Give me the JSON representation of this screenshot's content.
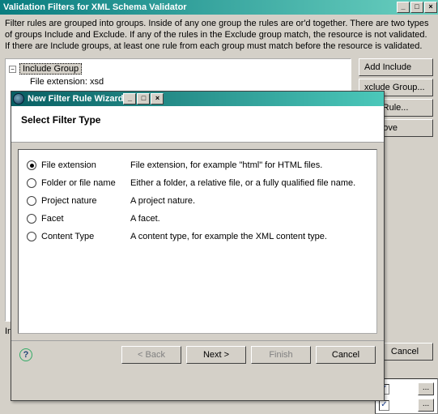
{
  "mainDialog": {
    "title": "Validation Filters for XML Schema Validator",
    "description": "Filter rules are grouped into groups. Inside of any one group the rules are or'd together. There are two types of groups Include and Exclude. If any of the rules in the Exclude group match, the resource is not validated. If there are Include groups, at least one rule from each group must match before the resource is validated.",
    "tree": {
      "root": "Include Group",
      "child": "File extension: xsd"
    },
    "sideButtons": {
      "addIncludeGroup": "Add Include Group...",
      "addExcludeGroup": "xclude Group...",
      "addRule": "Add Rule...",
      "remove": "Remove"
    },
    "includeLabel": "In",
    "cancel": "Cancel"
  },
  "bottom": {
    "dots": "..."
  },
  "wizard": {
    "title": "New Filter Rule Wizard",
    "heading": "Select Filter Type",
    "options": [
      {
        "label": "File extension",
        "desc": "File extension, for example \"html\" for HTML files.",
        "selected": true
      },
      {
        "label": "Folder or file name",
        "desc": "Either a folder, a relative file, or a fully qualified file name.",
        "selected": false
      },
      {
        "label": "Project nature",
        "desc": "A project nature.",
        "selected": false
      },
      {
        "label": "Facet",
        "desc": "A facet.",
        "selected": false
      },
      {
        "label": "Content Type",
        "desc": "A content type, for example the XML content type.",
        "selected": false
      }
    ],
    "buttons": {
      "back": "< Back",
      "next": "Next >",
      "finish": "Finish",
      "cancel": "Cancel"
    }
  }
}
